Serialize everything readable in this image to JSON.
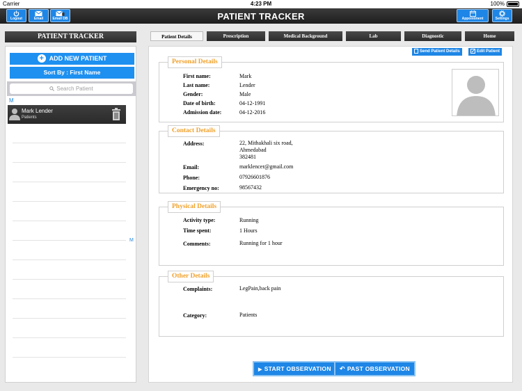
{
  "status_bar": {
    "carrier": "Carrier",
    "time": "4:23 PM",
    "battery": "100%"
  },
  "header": {
    "title": "PATIENT TRACKER",
    "buttons": {
      "logout": "Logout",
      "email": "Email",
      "email_db": "Email DB",
      "appointment": "Appointment",
      "settings": "Settings"
    }
  },
  "sidebar": {
    "title": "PATIENT TRACKER",
    "add_button": "ADD NEW PATIENT",
    "sort_button": "Sort By : First Name",
    "search_placeholder": "Search Patient",
    "section_letter": "M",
    "index_letter": "M",
    "patients": [
      {
        "name": "Mark Lender",
        "subtitle": "Patients"
      }
    ]
  },
  "tabs": [
    "Patient Details",
    "Prescription",
    "Medical Background",
    "Lab",
    "Diagnostic",
    "Home"
  ],
  "actions": {
    "send": "Send Patient Details",
    "edit": "Edit Patient"
  },
  "personal": {
    "title": "Personal Details",
    "fields": [
      {
        "label": "First name:",
        "value": "Mark"
      },
      {
        "label": "Last name:",
        "value": "Lender"
      },
      {
        "label": "Gender:",
        "value": "Male"
      },
      {
        "label": "Date of birth:",
        "value": "04-12-1991"
      },
      {
        "label": "Admission date:",
        "value": "04-12-2016"
      }
    ]
  },
  "contact": {
    "title": "Contact Details",
    "fields": [
      {
        "label": "Address:",
        "value": "22, Mithakhali six road,\nAhmedabad\n382481"
      },
      {
        "label": "Email:",
        "value": "marklencer@gmail.com"
      },
      {
        "label": "Phone:",
        "value": "07926601876"
      },
      {
        "label": "Emergency no:",
        "value": "98567432"
      }
    ]
  },
  "physical": {
    "title": "Physical Details",
    "fields": [
      {
        "label": "Activity type:",
        "value": "Running"
      },
      {
        "label": "Time spent:",
        "value": "1 Hours"
      },
      {
        "label": "Comments:",
        "value": "Running for 1 hour"
      }
    ]
  },
  "other": {
    "title": "Other Details",
    "fields": [
      {
        "label": "Complaints:",
        "value": "LegPain,back pain"
      },
      {
        "label": "Category:",
        "value": "Patients"
      }
    ]
  },
  "buttons": {
    "start": "START OBSERVATION",
    "past": "PAST OBSERVATION"
  },
  "colors": {
    "accent": "#1e86e6",
    "legend": "#f0a12a",
    "header": "#2a2a2a"
  }
}
